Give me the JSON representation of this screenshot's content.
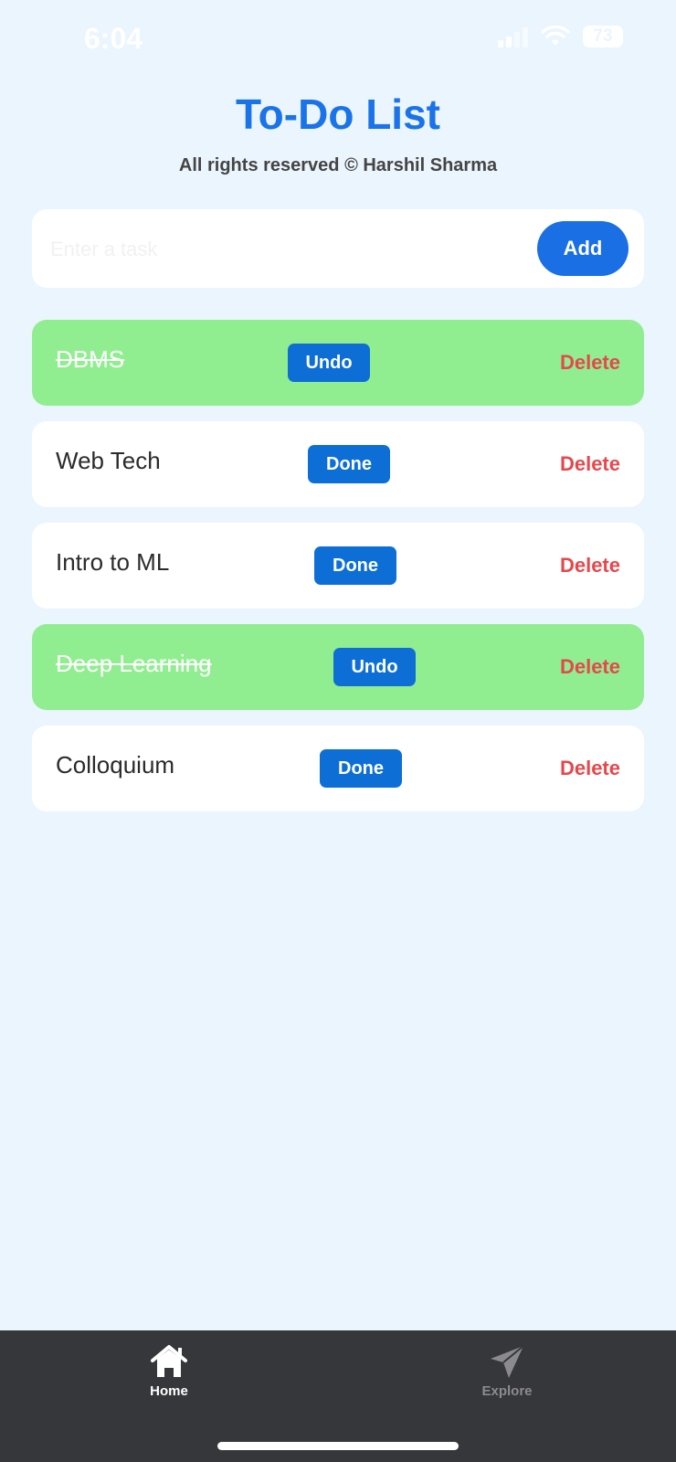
{
  "status_bar": {
    "time": "6:04",
    "battery": "73",
    "icons": [
      "signal-icon",
      "wifi-icon",
      "battery-icon"
    ]
  },
  "header": {
    "title": "To-Do List",
    "subtitle": "All rights reserved © Harshil Sharma"
  },
  "input": {
    "placeholder": "Enter a task",
    "value": "",
    "add_label": "Add"
  },
  "tasks": [
    {
      "label": "DBMS",
      "completed": true,
      "action_label": "Undo",
      "delete_label": "Delete"
    },
    {
      "label": "Web Tech",
      "completed": false,
      "action_label": "Done",
      "delete_label": "Delete"
    },
    {
      "label": "Intro to ML",
      "completed": false,
      "action_label": "Done",
      "delete_label": "Delete"
    },
    {
      "label": "Deep Learning",
      "completed": true,
      "action_label": "Undo",
      "delete_label": "Delete"
    },
    {
      "label": "Colloquium",
      "completed": false,
      "action_label": "Done",
      "delete_label": "Delete"
    }
  ],
  "tab_bar": {
    "tabs": [
      {
        "label": "Home",
        "icon": "home-icon",
        "active": true
      },
      {
        "label": "Explore",
        "icon": "send-icon",
        "active": false
      }
    ]
  },
  "colors": {
    "background": "#ebf5fd",
    "accent": "#1a73e8",
    "completed_row": "#90ee90",
    "delete": "#e5484d",
    "tab_bar": "#36373a"
  }
}
